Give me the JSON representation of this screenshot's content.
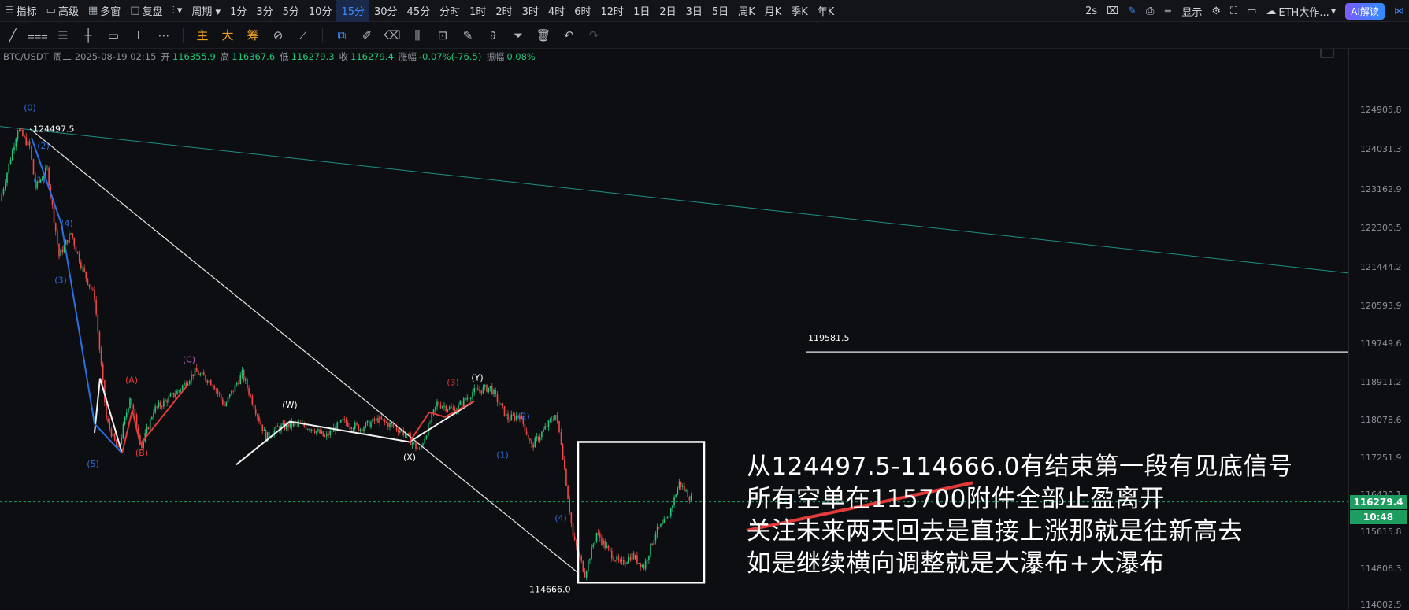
{
  "topbar": {
    "items": [
      {
        "icon": "☰",
        "label": "指标"
      },
      {
        "icon": "▭",
        "label": "高级"
      },
      {
        "icon": "▦",
        "label": "多窗"
      },
      {
        "icon": "◫",
        "label": "复盘"
      },
      {
        "icon": "⫶",
        "label": "▾"
      },
      {
        "label": "周期 ▾"
      }
    ],
    "intervals": [
      "1分",
      "3分",
      "5分",
      "10分",
      "15分",
      "30分",
      "45分",
      "分时",
      "1时",
      "2时",
      "3时",
      "4时",
      "6时",
      "12时",
      "1日",
      "2日",
      "3日",
      "5日",
      "周K",
      "月K",
      "季K",
      "年K"
    ],
    "active_interval": "15分",
    "right": {
      "speed": "2s",
      "display": "显示",
      "symbol_btn": "ETH大作...",
      "ai": "AI解读"
    }
  },
  "toolbar": {
    "highlight": [
      "主",
      "大",
      "筹"
    ]
  },
  "info": {
    "symbol": "BTC/USDT",
    "weekday": "周二",
    "datetime": "2025-08-19 02:15",
    "open_label": "开",
    "open": "116355.9",
    "high_label": "高",
    "high": "116367.6",
    "low_label": "低",
    "low": "116279.3",
    "close_label": "收",
    "close": "116279.4",
    "change_label": "涨幅",
    "change": "-0.07%(-76.5)",
    "amp_label": "振幅",
    "amp": "0.08%"
  },
  "chart_data": {
    "type": "candlestick",
    "title": "BTC/USDT",
    "y_ticks": [
      "124905.8",
      "124031.3",
      "123162.9",
      "122300.5",
      "121444.2",
      "120593.9",
      "119749.6",
      "118911.2",
      "118078.6",
      "117251.9",
      "116430.1",
      "115615.8",
      "114806.3",
      "114002.5"
    ],
    "ylim": [
      113950,
      125600
    ],
    "current_price": "116279.4",
    "countdown": "10:48",
    "high_marker": "124497.5",
    "low_marker": "114666.0",
    "level_line": "119581.5",
    "wave_labels": [
      "(0)",
      "(2)",
      "(1)",
      "(4)",
      "(3)",
      "(5)",
      "(A)",
      "(B)",
      "(C)",
      "(X)",
      "(W)",
      "(Y)",
      "(2)",
      "(1)",
      "(3)",
      "(4)"
    ],
    "path": [
      [
        0,
        122900
      ],
      [
        0.03,
        124497.5
      ],
      [
        0.05,
        124100
      ],
      [
        0.06,
        123200
      ],
      [
        0.08,
        123600
      ],
      [
        0.1,
        121700
      ],
      [
        0.12,
        122200
      ],
      [
        0.14,
        121400
      ],
      [
        0.16,
        120800
      ],
      [
        0.18,
        118100
      ],
      [
        0.2,
        117400
      ],
      [
        0.22,
        118600
      ],
      [
        0.24,
        117500
      ],
      [
        0.26,
        118300
      ],
      [
        0.3,
        118700
      ],
      [
        0.33,
        119150
      ],
      [
        0.36,
        118900
      ],
      [
        0.38,
        118400
      ],
      [
        0.41,
        119100
      ],
      [
        0.45,
        117700
      ],
      [
        0.47,
        117900
      ],
      [
        0.5,
        118000
      ],
      [
        0.53,
        117900
      ],
      [
        0.55,
        117700
      ],
      [
        0.58,
        118050
      ],
      [
        0.61,
        117900
      ],
      [
        0.64,
        118100
      ],
      [
        0.68,
        117850
      ],
      [
        0.71,
        117400
      ],
      [
        0.74,
        118450
      ],
      [
        0.77,
        118300
      ],
      [
        0.8,
        118700
      ],
      [
        0.83,
        118800
      ],
      [
        0.86,
        118100
      ],
      [
        0.88,
        118200
      ],
      [
        0.9,
        117500
      ],
      [
        0.92,
        117850
      ],
      [
        0.94,
        118200
      ],
      [
        0.95,
        117600
      ],
      [
        0.97,
        115500
      ],
      [
        0.99,
        114700
      ],
      [
        1.01,
        115600
      ],
      [
        1.03,
        115200
      ],
      [
        1.05,
        114900
      ],
      [
        1.07,
        115100
      ],
      [
        1.09,
        114850
      ],
      [
        1.11,
        115600
      ],
      [
        1.13,
        115900
      ],
      [
        1.15,
        116700
      ],
      [
        1.17,
        116350
      ]
    ]
  },
  "annotation": {
    "lines": [
      "从124497.5-114666.0有结束第一段有见底信号",
      "所有空单在115700附件全部止盈离开",
      "关注未来两天回去是直接上涨那就是往新高去",
      "如是继续横向调整就是大瀑布+大瀑布"
    ]
  }
}
